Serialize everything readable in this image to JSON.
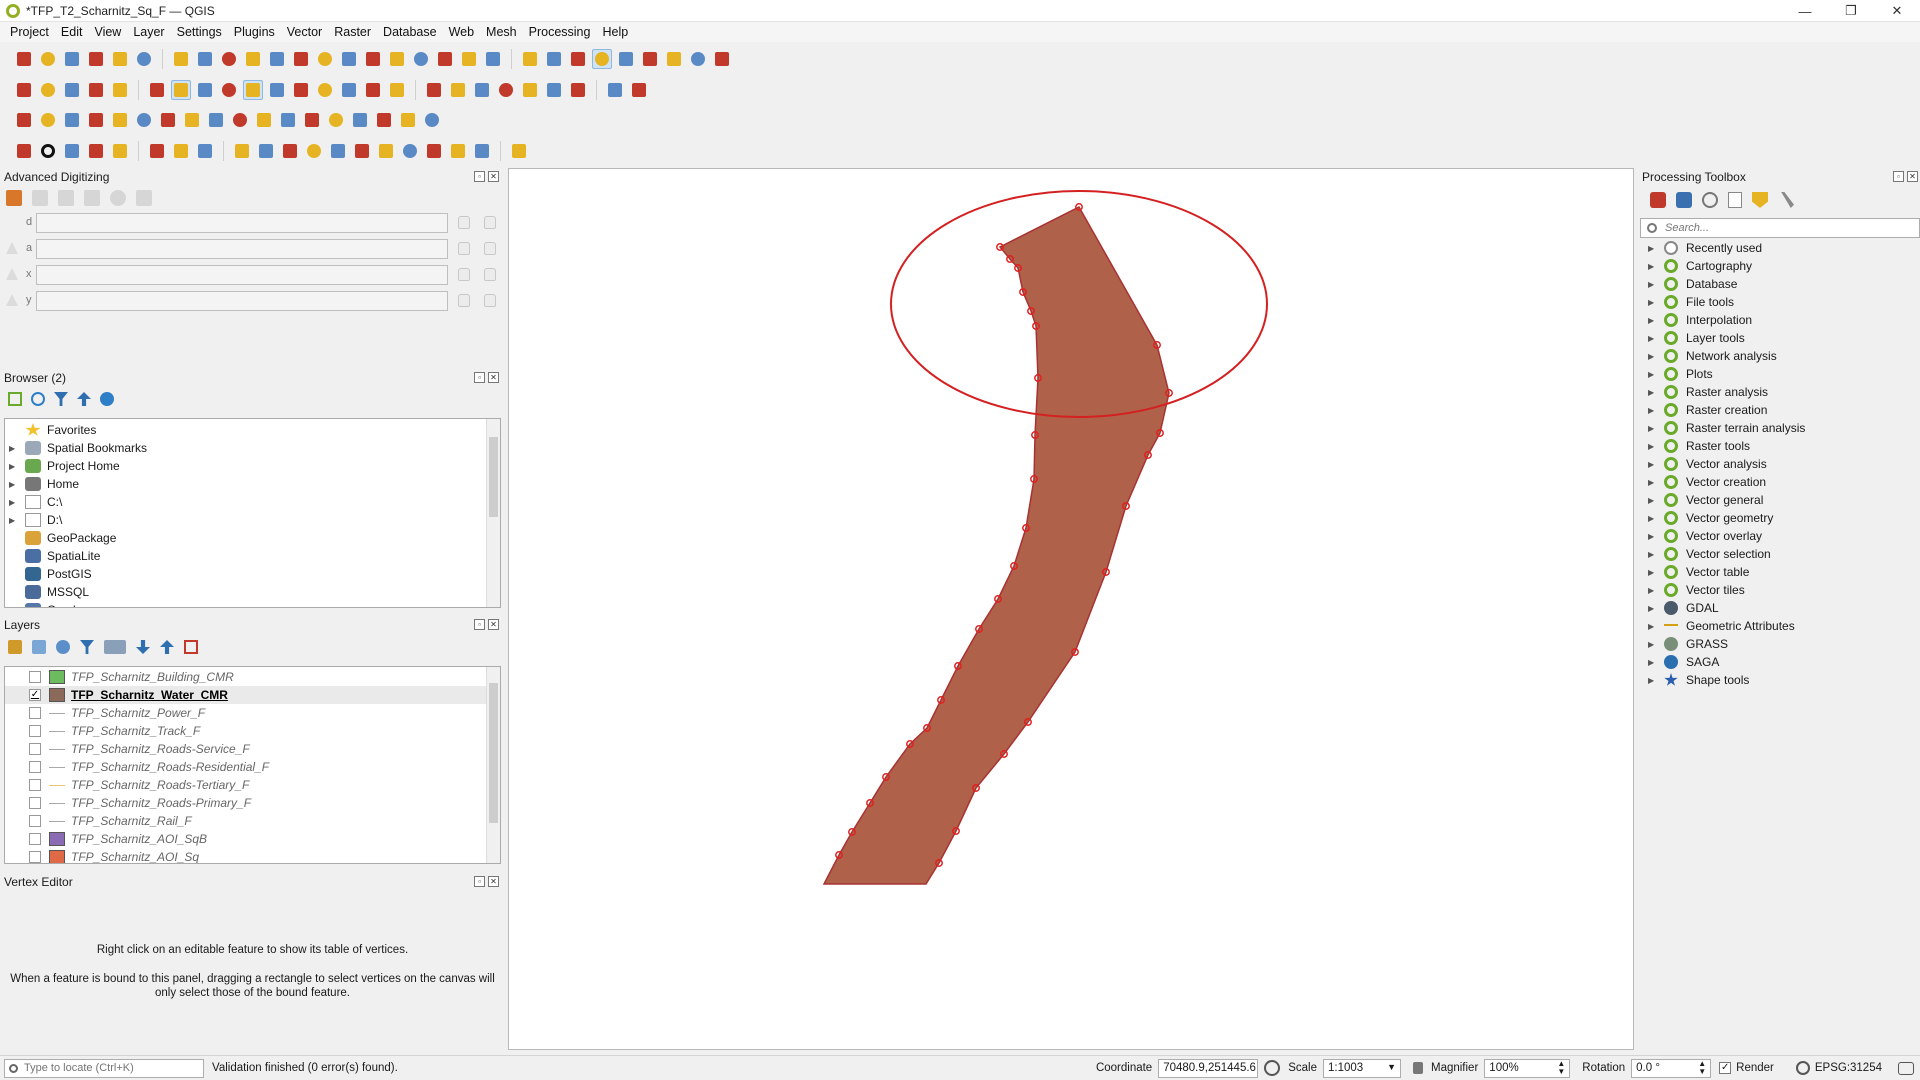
{
  "window": {
    "title": "*TFP_T2_Scharnitz_Sq_F — QGIS",
    "min": "—",
    "max": "❐",
    "close": "✕"
  },
  "menu": [
    "Project",
    "Edit",
    "View",
    "Layer",
    "Settings",
    "Plugins",
    "Vector",
    "Raster",
    "Database",
    "Web",
    "Mesh",
    "Processing",
    "Help"
  ],
  "advanced_digitizing": {
    "title": "Advanced Digitizing",
    "fields": [
      {
        "label": "d",
        "value": ""
      },
      {
        "label": "a",
        "value": ""
      },
      {
        "label": "x",
        "value": ""
      },
      {
        "label": "y",
        "value": ""
      }
    ]
  },
  "browser": {
    "title": "Browser (2)",
    "items": [
      {
        "label": "Favorites",
        "icon": "star-icon",
        "color": "#f2c12e",
        "expand": false
      },
      {
        "label": "Spatial Bookmarks",
        "icon": "bookmark-icon",
        "color": "#9aa8b8",
        "expand": true
      },
      {
        "label": "Project Home",
        "icon": "project-home-icon",
        "color": "#6aa84f",
        "expand": true
      },
      {
        "label": "Home",
        "icon": "home-icon",
        "color": "#777777",
        "expand": true
      },
      {
        "label": "C:\\",
        "icon": "folder-icon",
        "color": "#999999",
        "expand": true
      },
      {
        "label": "D:\\",
        "icon": "folder-icon",
        "color": "#999999",
        "expand": true
      },
      {
        "label": "GeoPackage",
        "icon": "geopackage-icon",
        "color": "#d9a33a",
        "expand": false
      },
      {
        "label": "SpatiaLite",
        "icon": "spatialite-icon",
        "color": "#4a6fa5",
        "expand": false
      },
      {
        "label": "PostGIS",
        "icon": "postgis-icon",
        "color": "#336791",
        "expand": false
      },
      {
        "label": "MSSQL",
        "icon": "mssql-icon",
        "color": "#4b6c9a",
        "expand": false
      },
      {
        "label": "Oracle",
        "icon": "oracle-icon",
        "color": "#5577aa",
        "expand": false
      }
    ]
  },
  "layers": {
    "title": "Layers",
    "items": [
      {
        "label": "TFP_Scharnitz_Building_CMR",
        "type": "poly",
        "color": "#6dbb5f",
        "checked": false,
        "selected": false
      },
      {
        "label": "TFP_Scharnitz_Water_CMR",
        "type": "poly",
        "color": "#8c6a5a",
        "checked": true,
        "selected": true
      },
      {
        "label": "TFP_Scharnitz_Power_F",
        "type": "line",
        "color": "#a9a9a9",
        "checked": false,
        "selected": false
      },
      {
        "label": "TFP_Scharnitz_Track_F",
        "type": "line",
        "color": "#a9a9a9",
        "checked": false,
        "selected": false
      },
      {
        "label": "TFP_Scharnitz_Roads-Service_F",
        "type": "line",
        "color": "#a9a9a9",
        "checked": false,
        "selected": false
      },
      {
        "label": "TFP_Scharnitz_Roads-Residential_F",
        "type": "line",
        "color": "#a9a9a9",
        "checked": false,
        "selected": false
      },
      {
        "label": "TFP_Scharnitz_Roads-Tertiary_F",
        "type": "line",
        "color": "#e8c37a",
        "checked": false,
        "selected": false
      },
      {
        "label": "TFP_Scharnitz_Roads-Primary_F",
        "type": "line",
        "color": "#a9a9a9",
        "checked": false,
        "selected": false
      },
      {
        "label": "TFP_Scharnitz_Rail_F",
        "type": "line",
        "color": "#a9a9a9",
        "checked": false,
        "selected": false
      },
      {
        "label": "TFP_Scharnitz_AOI_SqB",
        "type": "poly",
        "color": "#8c6bb5",
        "checked": false,
        "selected": false
      },
      {
        "label": "TFP_Scharnitz_AOI_Sq",
        "type": "poly",
        "color": "#e06a45",
        "checked": false,
        "selected": false
      }
    ]
  },
  "vertex_editor": {
    "title": "Vertex Editor",
    "hint1": "Right click on an editable feature to show its table of vertices.",
    "hint2": "When a feature is bound to this panel, dragging a rectangle to select vertices on the canvas will only select those of the bound feature."
  },
  "processing": {
    "title": "Processing Toolbox",
    "search_placeholder": "Search...",
    "items": [
      {
        "label": "Recently used",
        "icon": "clock-icon",
        "color": "#888888"
      },
      {
        "label": "Cartography",
        "icon": "qgis-icon",
        "color": "#6aaa2a"
      },
      {
        "label": "Database",
        "icon": "qgis-icon",
        "color": "#6aaa2a"
      },
      {
        "label": "File tools",
        "icon": "qgis-icon",
        "color": "#6aaa2a"
      },
      {
        "label": "Interpolation",
        "icon": "qgis-icon",
        "color": "#6aaa2a"
      },
      {
        "label": "Layer tools",
        "icon": "qgis-icon",
        "color": "#6aaa2a"
      },
      {
        "label": "Network analysis",
        "icon": "qgis-icon",
        "color": "#6aaa2a"
      },
      {
        "label": "Plots",
        "icon": "qgis-icon",
        "color": "#6aaa2a"
      },
      {
        "label": "Raster analysis",
        "icon": "qgis-icon",
        "color": "#6aaa2a"
      },
      {
        "label": "Raster creation",
        "icon": "qgis-icon",
        "color": "#6aaa2a"
      },
      {
        "label": "Raster terrain analysis",
        "icon": "qgis-icon",
        "color": "#6aaa2a"
      },
      {
        "label": "Raster tools",
        "icon": "qgis-icon",
        "color": "#6aaa2a"
      },
      {
        "label": "Vector analysis",
        "icon": "qgis-icon",
        "color": "#6aaa2a"
      },
      {
        "label": "Vector creation",
        "icon": "qgis-icon",
        "color": "#6aaa2a"
      },
      {
        "label": "Vector general",
        "icon": "qgis-icon",
        "color": "#6aaa2a"
      },
      {
        "label": "Vector geometry",
        "icon": "qgis-icon",
        "color": "#6aaa2a"
      },
      {
        "label": "Vector overlay",
        "icon": "qgis-icon",
        "color": "#6aaa2a"
      },
      {
        "label": "Vector selection",
        "icon": "qgis-icon",
        "color": "#6aaa2a"
      },
      {
        "label": "Vector table",
        "icon": "qgis-icon",
        "color": "#6aaa2a"
      },
      {
        "label": "Vector tiles",
        "icon": "qgis-icon",
        "color": "#6aaa2a"
      },
      {
        "label": "GDAL",
        "icon": "gdal-icon",
        "color": "#4a5a6a"
      },
      {
        "label": "Geometric Attributes",
        "icon": "geometric-attributes-icon",
        "color": "#d4a017"
      },
      {
        "label": "GRASS",
        "icon": "grass-icon",
        "color": "#7a8f7a"
      },
      {
        "label": "SAGA",
        "icon": "saga-icon",
        "color": "#2a6fb0"
      },
      {
        "label": "Shape tools",
        "icon": "shape-tools-icon",
        "color": "#2a5db0"
      }
    ]
  },
  "status": {
    "locator_placeholder": "Type to locate (Ctrl+K)",
    "message": "Validation finished (0 error(s) found).",
    "coordinate_label": "Coordinate",
    "coordinate": "70480.9,251445.6",
    "scale_label": "Scale",
    "scale": "1:1003",
    "magnifier_label": "Magnifier",
    "magnifier": "100%",
    "rotation_label": "Rotation",
    "rotation": "0.0 °",
    "render_label": "Render",
    "crs": "EPSG:31254"
  },
  "colors": {
    "feature_fill": "#b0614a",
    "feature_stroke": "#a83232",
    "vertex": "#e02020",
    "selection_ellipse": "#d42020"
  }
}
